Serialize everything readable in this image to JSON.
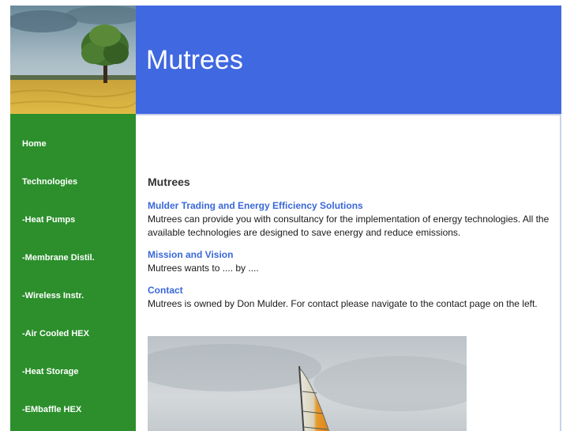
{
  "site": {
    "title": "Mutrees"
  },
  "nav": [
    {
      "label": "Home"
    },
    {
      "label": "Technologies"
    },
    {
      "label": "-Heat Pumps"
    },
    {
      "label": "-Membrane Distil."
    },
    {
      "label": "-Wireless Instr."
    },
    {
      "label": "-Air Cooled HEX"
    },
    {
      "label": "-Heat Storage"
    },
    {
      "label": "-EMbaffle HEX"
    }
  ],
  "main": {
    "heading": "Mutrees",
    "sections": [
      {
        "title": "Mulder Trading and Energy Efficiency Solutions",
        "line1": "Mutrees can provide you with consultancy for the implementation of energy technologies. All the",
        "line2": "available technologies are designed to save energy and reduce emissions."
      },
      {
        "title": "Mission and Vision",
        "line1": "Mutrees wants to .... by ...."
      },
      {
        "title": "Contact",
        "line1": "Mutrees is owned by Don Mulder. For contact please navigate to the contact page on the left."
      }
    ]
  },
  "colors": {
    "header_blue": "#4068e0",
    "sidebar_green": "#2c8f2c",
    "link_blue": "#3a68d8"
  },
  "images": {
    "header": "field-tree-photo",
    "content": "sailboat-photo"
  }
}
